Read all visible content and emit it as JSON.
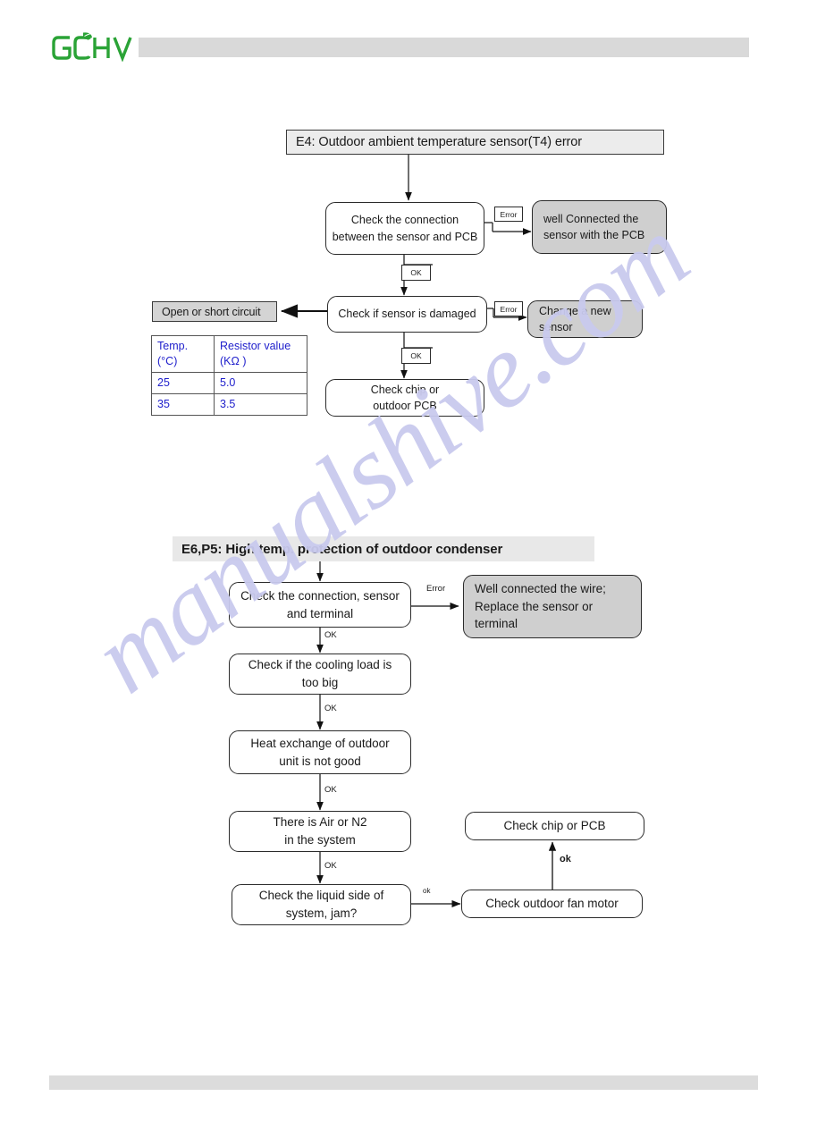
{
  "page": {
    "logo_text": "GCHV",
    "logo_color": "#2aa336",
    "header_band_color": "#d9d9d9",
    "footer_band_color": "#dcdcdc",
    "watermark_text": "manualshive.com",
    "watermark_color": "#c9caee"
  },
  "flow_e4": {
    "title": "E4: Outdoor ambient temperature sensor(T4) error",
    "nodes": {
      "check_connection": "Check the connection\nbetween the sensor and PCB",
      "check_connection_l1": "Check the connection",
      "check_connection_l2": "between the sensor and PCB",
      "well_connected_l1": "well Connected  the",
      "well_connected_l2": "sensor  with the  PCB",
      "check_damaged": "Check if sensor is damaged",
      "change_sensor_l1": "Change a new",
      "change_sensor_l2": "sensor",
      "open_short": "Open or short circuit",
      "check_chip_l1": "Check chip or",
      "check_chip_l2": "outdoor PCB"
    },
    "edge_labels": {
      "error_1": "Error",
      "ok_1": "OK",
      "error_2": "Error",
      "ok_2": "OK"
    },
    "table": {
      "headers": [
        "Temp.\n(°C)",
        "Resistor value\n(KΩ )"
      ],
      "header_1_l1": "Temp.",
      "header_1_l2": "(°C)",
      "header_2_l1": "Resistor value",
      "header_2_l2": "(KΩ )",
      "rows": [
        {
          "temp": "25",
          "resistor": "5.0"
        },
        {
          "temp": "35",
          "resistor": "3.5"
        }
      ],
      "text_color": "#2020cc"
    }
  },
  "flow_e6p5": {
    "title": "E6,P5: High temp. protection of outdoor condenser",
    "nodes": {
      "check_conn_l1": "Check the connection, sensor",
      "check_conn_l2": "and terminal",
      "well_connected_l1": "Well connected the wire;",
      "well_connected_l2": "Replace the sensor or",
      "well_connected_l3": "terminal",
      "cooling_load_l1": "Check if the cooling load is",
      "cooling_load_l2": "too big",
      "heat_exchange_l1": "Heat exchange of outdoor",
      "heat_exchange_l2": "unit is not good",
      "air_n2_l1": "There is Air or N2",
      "air_n2_l2": "in the system",
      "liquid_side_l1": "Check the liquid side of",
      "liquid_side_l2": "system, jam?",
      "fan_motor": "Check outdoor fan motor",
      "check_chip": "Check chip or PCB"
    },
    "edge_labels": {
      "error_1": "Error",
      "ok_1": "OK",
      "ok_2": "OK",
      "ok_3": "OK",
      "ok_4": "OK",
      "ok_5": "ok",
      "ok_6": "ok"
    }
  }
}
